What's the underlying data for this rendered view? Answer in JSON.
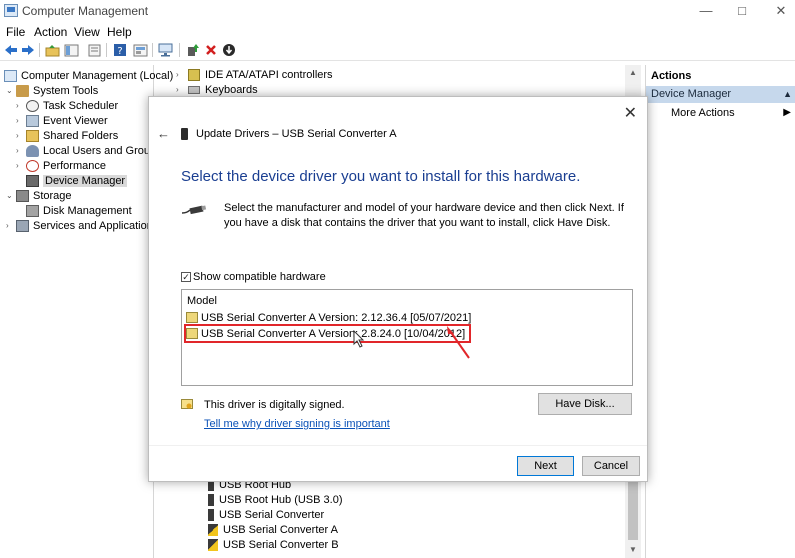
{
  "window": {
    "title": "Computer Management",
    "controls": [
      "—",
      "□",
      "✕"
    ]
  },
  "menu": [
    "File",
    "Action",
    "View",
    "Help"
  ],
  "toolbar": {
    "icons": [
      "back-icon",
      "forward-icon",
      "up-folder-icon",
      "show-tree-icon",
      "export-list-icon",
      "help-icon",
      "properties-icon",
      "scan-hardware-icon",
      "update-driver-icon",
      "uninstall-icon",
      "disable-device-icon"
    ]
  },
  "tree": {
    "root": "Computer Management (Local)",
    "system_tools": "System Tools",
    "task_scheduler": "Task Scheduler",
    "event_viewer": "Event Viewer",
    "shared_folders": "Shared Folders",
    "local_users": "Local Users and Groups",
    "performance": "Performance",
    "device_manager": "Device Manager",
    "storage": "Storage",
    "disk_management": "Disk Management",
    "services": "Services and Applications"
  },
  "devices": {
    "top": [
      "IDE ATA/ATAPI controllers",
      "Keyboards"
    ],
    "bottom": [
      "USB Root Hub",
      "USB Root Hub (USB 3.0)",
      "USB Serial Converter",
      "USB Serial Converter A",
      "USB Serial Converter B"
    ]
  },
  "actions": {
    "header": "Actions",
    "section": "Device Manager",
    "more": "More Actions"
  },
  "dialog": {
    "title": "Update Drivers – USB Serial Converter A",
    "heading": "Select the device driver you want to install for this hardware.",
    "description": "Select the manufacturer and model of your hardware device and then click Next. If you have a disk that contains the driver that you want to install, click Have Disk.",
    "show_compatible_label": "Show compatible hardware",
    "show_compatible_checked": true,
    "model_header": "Model",
    "models": [
      "USB Serial Converter A Version: 2.12.36.4 [05/07/2021]",
      "USB Serial Converter A Version: 2.8.24.0 [10/04/2012]"
    ],
    "highlighted_model_index": 1,
    "signed_text": "This driver is digitally signed.",
    "signing_link": "Tell me why driver signing is important",
    "have_disk": "Have Disk...",
    "next": "Next",
    "cancel": "Cancel"
  },
  "colors": {
    "heading_blue": "#1a3e91",
    "link_blue": "#0b52b7",
    "highlight_red": "#e1262a",
    "selection_blue": "#c6d8ec"
  }
}
